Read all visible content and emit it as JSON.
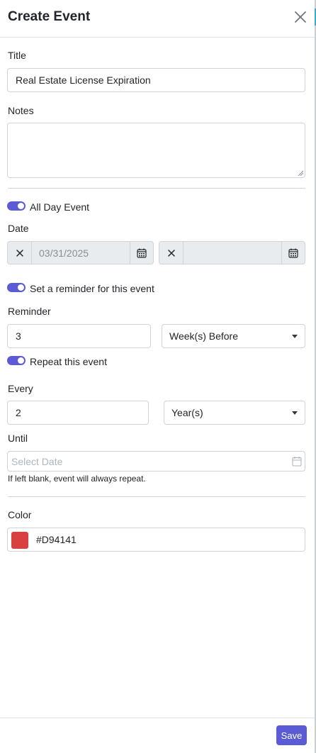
{
  "header": {
    "title": "Create Event",
    "close_icon": "close-icon"
  },
  "form": {
    "title_label": "Title",
    "title_value": "Real Estate License Expiration",
    "notes_label": "Notes",
    "notes_value": "",
    "all_day": {
      "label": "All Day Event",
      "checked": true
    },
    "date_label": "Date",
    "start_date": "03/31/2025",
    "end_date": "",
    "reminder_toggle": {
      "label": "Set a reminder for this event",
      "checked": true
    },
    "reminder_label": "Reminder",
    "reminder_value": "3",
    "reminder_unit": "Week(s) Before",
    "repeat_toggle": {
      "label": "Repeat this event",
      "checked": true
    },
    "every_label": "Every",
    "every_value": "2",
    "every_unit": "Year(s)",
    "until_label": "Until",
    "until_placeholder": "Select Date",
    "until_hint": "If left blank, event will always repeat.",
    "color_label": "Color",
    "color_value": "#D94141"
  },
  "colors": {
    "accent": "#5b5bd6",
    "swatch": "#D94141"
  },
  "footer": {
    "save_label": "Save"
  }
}
